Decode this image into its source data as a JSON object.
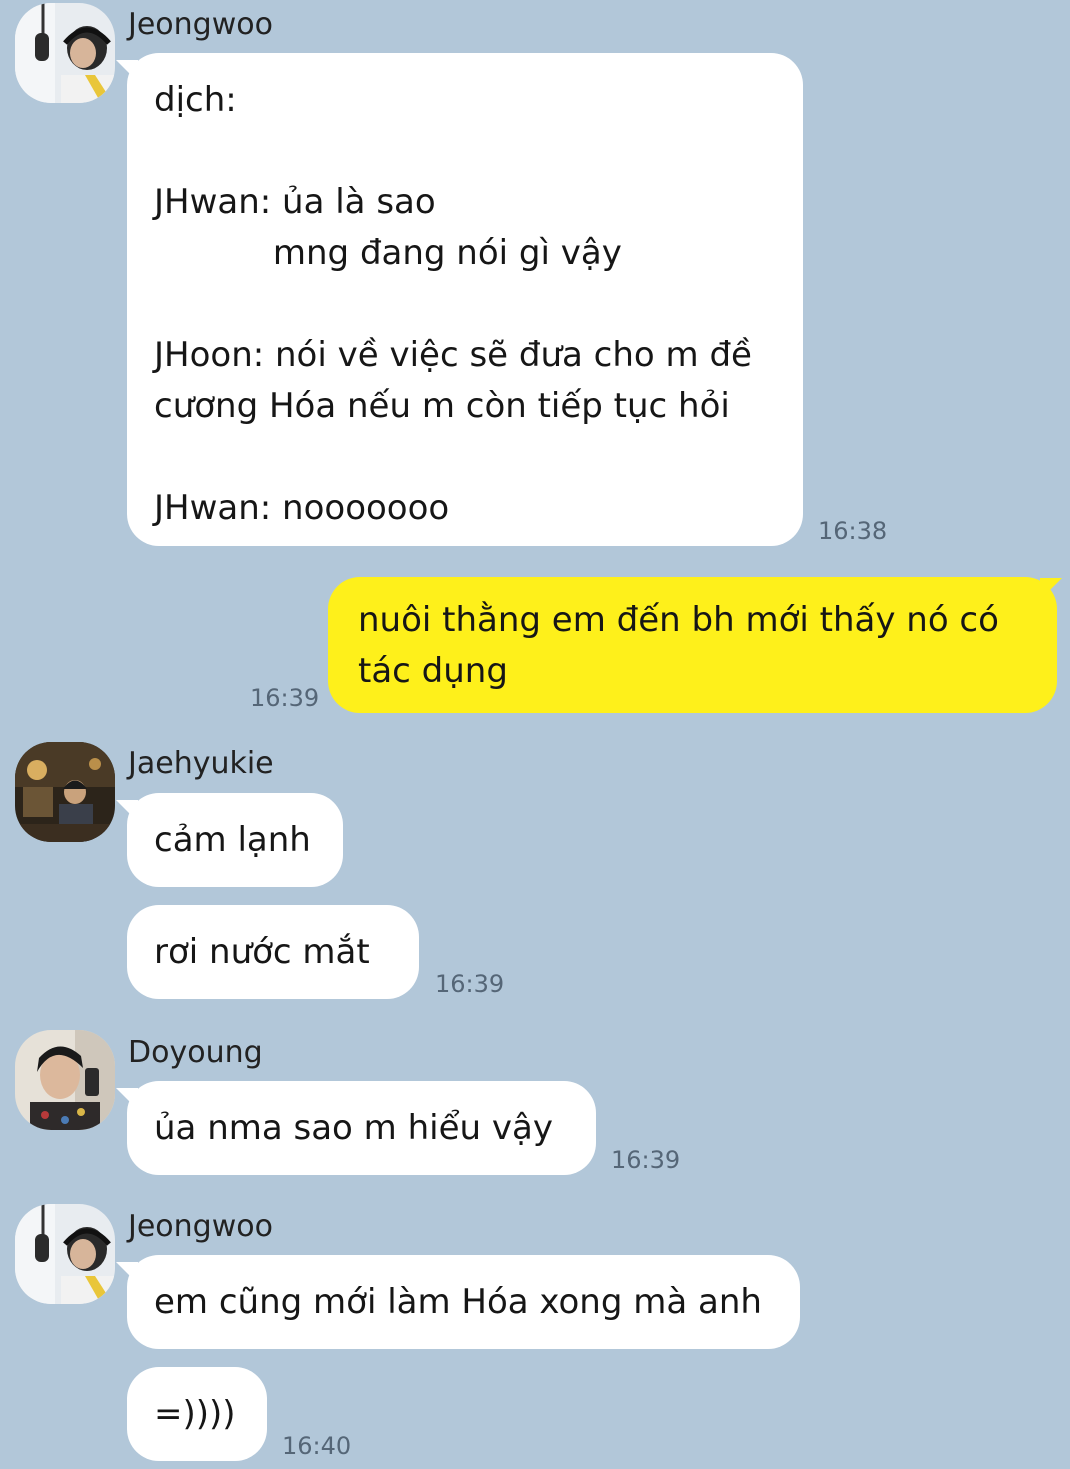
{
  "colors": {
    "background": "#b2c7d9",
    "incoming_bubble": "#ffffff",
    "outgoing_bubble": "#fef01b",
    "timestamp": "#556677"
  },
  "messages": {
    "m1": {
      "sender": "Jeongwoo",
      "avatar_icon": "person-with-headphones-avatar-icon",
      "text": "dịch:\n\nJHwan: ủa là sao\n           mng đang nói gì vậy\n\nJHoon: nói về việc sẽ đưa cho m đề\ncương Hóa nếu m còn tiếp tục hỏi\n\nJHwan: nooooooo",
      "time": "16:38"
    },
    "m2": {
      "text": "nuôi thằng em đến bh mới thấy nó có\ntác dụng",
      "time": "16:39"
    },
    "m3": {
      "sender": "Jaehyukie",
      "avatar_icon": "person-at-desk-avatar-icon",
      "text1": "cảm lạnh",
      "text2": "rơi nước mắt",
      "time": "16:39"
    },
    "m4": {
      "sender": "Doyoung",
      "avatar_icon": "mirror-selfie-avatar-icon",
      "text": "ủa nma sao m hiểu vậy",
      "time": "16:39"
    },
    "m5": {
      "sender": "Jeongwoo",
      "avatar_icon": "person-with-headphones-avatar-icon",
      "text1": "em cũng mới làm Hóa xong mà anh",
      "text2": "=))))",
      "time": "16:40"
    }
  }
}
